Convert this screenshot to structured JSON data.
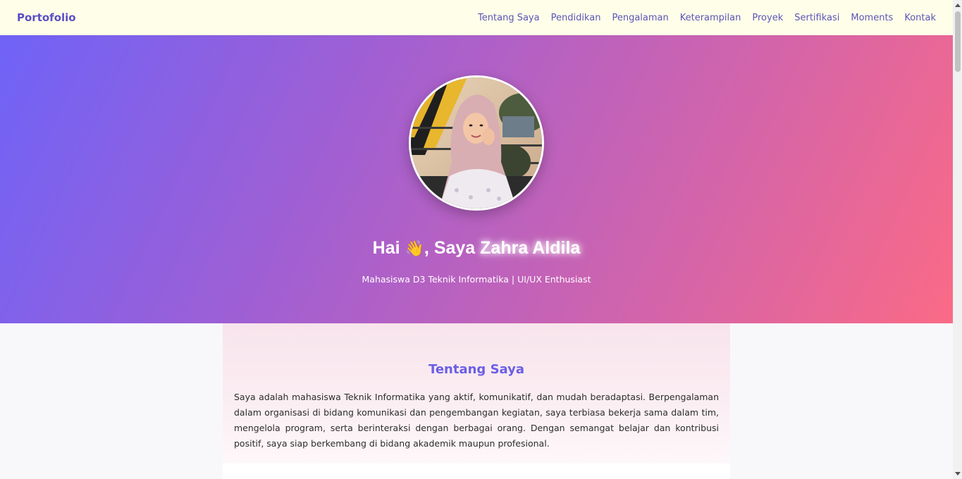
{
  "navbar": {
    "brand": "Portofolio",
    "links": [
      {
        "label": "Tentang Saya"
      },
      {
        "label": "Pendidikan"
      },
      {
        "label": "Pengalaman"
      },
      {
        "label": "Keterampilan"
      },
      {
        "label": "Proyek"
      },
      {
        "label": "Sertifikasi"
      },
      {
        "label": "Moments"
      },
      {
        "label": "Kontak"
      }
    ]
  },
  "hero": {
    "greeting_prefix": "Hai ",
    "wave": "👋",
    "greeting_middle": ", Saya ",
    "name": "Zahra Aldila",
    "subtitle": "Mahasiswa D3 Teknik Informatika | UI/UX Enthusiast",
    "avatar_icon": "profile-photo"
  },
  "about": {
    "title": "Tentang Saya",
    "text": "Saya adalah mahasiswa Teknik Informatika yang aktif, komunikatif, dan mudah beradaptasi. Berpengalaman dalam organisasi di bidang komunikasi dan pengembangan kegiatan, saya terbiasa bekerja sama dalam tim, mengelola program, serta berinteraksi dengan berbagai orang. Dengan semangat belajar dan kontribusi positif, saya siap berkembang di bidang akademik maupun profesional."
  },
  "colors": {
    "accent": "#6a5fe6",
    "navbar_bg": "#fefee9",
    "gradient_start": "#6f63f7",
    "gradient_end": "#fa6a86"
  }
}
